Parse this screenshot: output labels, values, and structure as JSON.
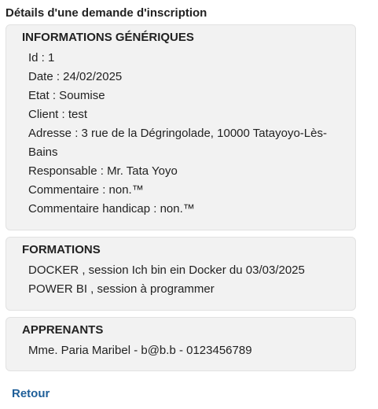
{
  "page": {
    "title": "Détails d'une demande d'inscription"
  },
  "generic": {
    "title": "INFORMATIONS GÉNÉRIQUES",
    "id": "Id : 1",
    "date": "Date : 24/02/2025",
    "etat": "Etat : Soumise",
    "client": "Client : test",
    "adresse_line1": "Adresse : 3 rue de la Dégringolade, 10000 Tatayoyo-Lès-",
    "adresse_line2": "Bains",
    "responsable": "Responsable : Mr. Tata Yoyo",
    "commentaire": "Commentaire : non.™",
    "commentaire_handicap": "Commentaire handicap : non.™"
  },
  "formations": {
    "title": "FORMATIONS",
    "items": [
      "DOCKER , session Ich bin ein Docker du 03/03/2025",
      "POWER BI , session à programmer"
    ]
  },
  "apprenants": {
    "title": "APPRENANTS",
    "items": [
      "Mme. Paria Maribel - b@b.b - 0123456789"
    ]
  },
  "footer": {
    "retour_label": "Retour"
  }
}
